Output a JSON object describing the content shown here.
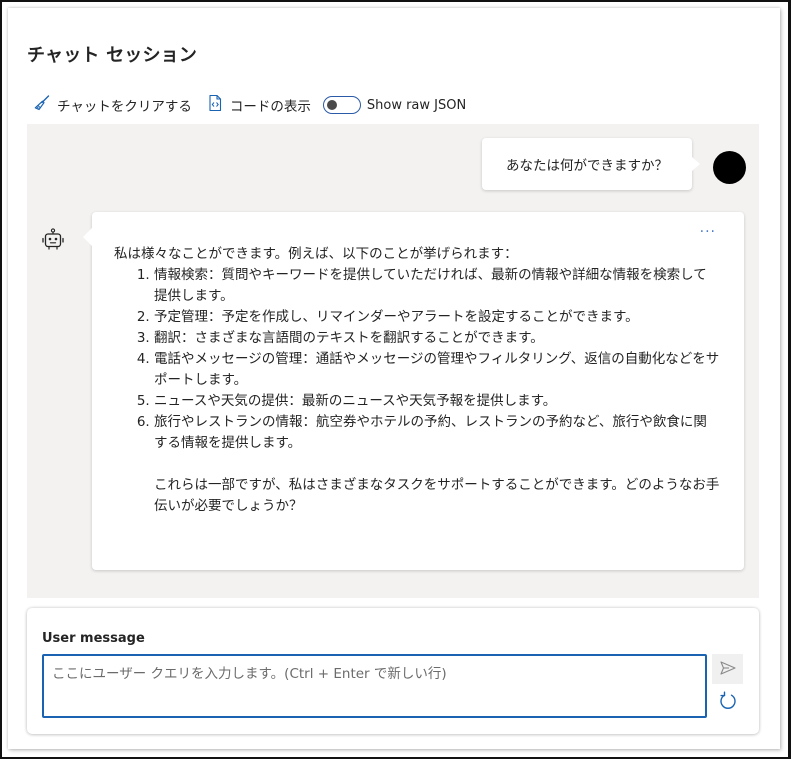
{
  "header": {
    "title": "チャット セッション"
  },
  "toolbar": {
    "clear_label": "チャットをクリアする",
    "code_label": "コードの表示",
    "raw_json_label": "Show raw JSON",
    "raw_json_on": false
  },
  "chat": {
    "user_message": "あなたは何ができますか？",
    "assistant": {
      "more_label": "···",
      "intro": "私は様々なことができます。例えば、以下のことが挙げられます：",
      "items": [
        "情報検索：質問やキーワードを提供していただければ、最新の情報や詳細な情報を検索して提供します。",
        "予定管理：予定を作成し、リマインダーやアラートを設定することができます。",
        "翻訳：さまざまな言語間のテキストを翻訳することができます。",
        "電話やメッセージの管理：通話やメッセージの管理やフィルタリング、返信の自動化などをサポートします。",
        "ニュースや天気の提供：最新のニュースや天気予報を提供します。",
        "旅行やレストランの情報：航空券やホテルの予約、レストランの予約など、旅行や飲食に関する情報を提供します。"
      ],
      "closing": "これらは一部ですが、私はさまざまなタスクをサポートすることができます。どのようなお手伝いが必要でしょうか？"
    }
  },
  "input": {
    "label": "User message",
    "placeholder": "ここにユーザー クエリを入力します。(Ctrl + Enter で新しい行)"
  },
  "icons": {
    "clear": "broom-icon",
    "code": "code-file-icon",
    "bot": "bot-icon",
    "send": "send-icon",
    "refresh": "refresh-icon"
  },
  "colors": {
    "accent": "#1a63b3",
    "chat_background": "#f3f2f1",
    "link": "#4a7cc9"
  }
}
